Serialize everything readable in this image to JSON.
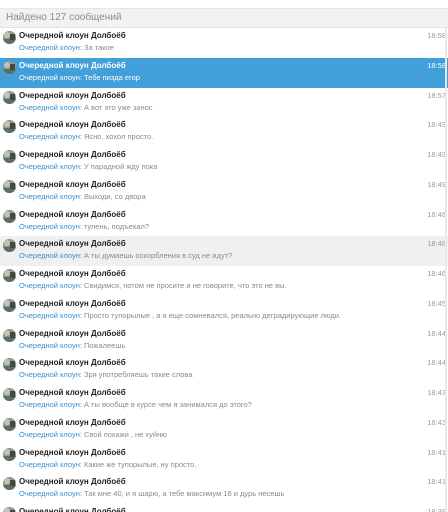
{
  "search": {
    "found_label": "Найдено 127 сообщений"
  },
  "colors": {
    "selected_bg": "#419fd9",
    "hover_bg": "#f0f0f0",
    "sender": "#3a8fd1",
    "preview": "#8a8a8a"
  },
  "messages": [
    {
      "chat": "Очередной клоун Долбоёб",
      "sender": "Очередной клоун",
      "colon": ":",
      "text": "За такое",
      "time": "18:58",
      "state": "normal"
    },
    {
      "chat": "Очередной клоун Долбоёб",
      "sender": "Очередной клоун",
      "colon": ":",
      "text": "Тебе пизда егор",
      "time": "18:58",
      "state": "selected"
    },
    {
      "chat": "Очередной клоун Долбоёб",
      "sender": "Очередной клоун",
      "colon": ":",
      "text": "А вот это уже занос",
      "time": "18:57",
      "state": "normal"
    },
    {
      "chat": "Очередной клоун Долбоёб",
      "sender": "Очередной клоун",
      "colon": ":",
      "text": "Ясно, хохол просто.",
      "time": "18:49",
      "state": "normal"
    },
    {
      "chat": "Очередной клоун Долбоёб",
      "sender": "Очередной клоун",
      "colon": ":",
      "text": "У парадной жду пока",
      "time": "18:49",
      "state": "normal"
    },
    {
      "chat": "Очередной клоун Долбоёб",
      "sender": "Очередной клоун",
      "colon": ":",
      "text": "Выходи, со двора",
      "time": "18:49",
      "state": "normal"
    },
    {
      "chat": "Очередной клоун Долбоёб",
      "sender": "Очередной клоун",
      "colon": ":",
      "text": "тупень, подъехал?",
      "time": "18:48",
      "state": "normal"
    },
    {
      "chat": "Очередной клоун Долбоёб",
      "sender": "Очередной клоун",
      "colon": ":",
      "text": "А ты думаешь оскорбления в суд не идут?",
      "time": "18:48",
      "state": "hovered"
    },
    {
      "chat": "Очередной клоун Долбоёб",
      "sender": "Очередной клоун",
      "colon": ":",
      "text": "Свидимся, потом не просите и не говорите, что это не вы.",
      "time": "18:46",
      "state": "normal"
    },
    {
      "chat": "Очередной клоун Долбоёб",
      "sender": "Очередной клоун",
      "colon": ":",
      "text": "Просто тупорылые , а я еще сомневался, реально деградирующие люди.",
      "time": "18:45",
      "state": "normal"
    },
    {
      "chat": "Очередной клоун Долбоёб",
      "sender": "Очередной клоун",
      "colon": ":",
      "text": "Пожалеешь",
      "time": "18:44",
      "state": "normal"
    },
    {
      "chat": "Очередной клоун Долбоёб",
      "sender": "Очередной клоун",
      "colon": ":",
      "text": "Зря употребляешь такие слова",
      "time": "18:44",
      "state": "normal"
    },
    {
      "chat": "Очередной клоун Долбоёб",
      "sender": "Очередной клоун",
      "colon": ":",
      "text": "А ты вообще в курсе чем я занимался до этого?",
      "time": "18:43",
      "state": "normal"
    },
    {
      "chat": "Очередной клоун Долбоёб",
      "sender": "Очередной клоун",
      "colon": ":",
      "text": "Свой покажи , не хуйню",
      "time": "18:43",
      "state": "normal"
    },
    {
      "chat": "Очередной клоун Долбоёб",
      "sender": "Очередной клоун",
      "colon": ":",
      "text": "Какие же тупорылые, ну просто.",
      "time": "18:41",
      "state": "normal"
    },
    {
      "chat": "Очередной клоун Долбоёб",
      "sender": "Очередной клоун",
      "colon": ":",
      "text": "Так мне 40, и я шарю, а тебе максимум 16 и дурь несешь",
      "time": "18:41",
      "state": "normal"
    },
    {
      "chat": "Очередной клоун Долбоёб",
      "sender": "Очередной клоун",
      "colon": ":",
      "text": "",
      "time": "18:39",
      "state": "normal"
    }
  ]
}
